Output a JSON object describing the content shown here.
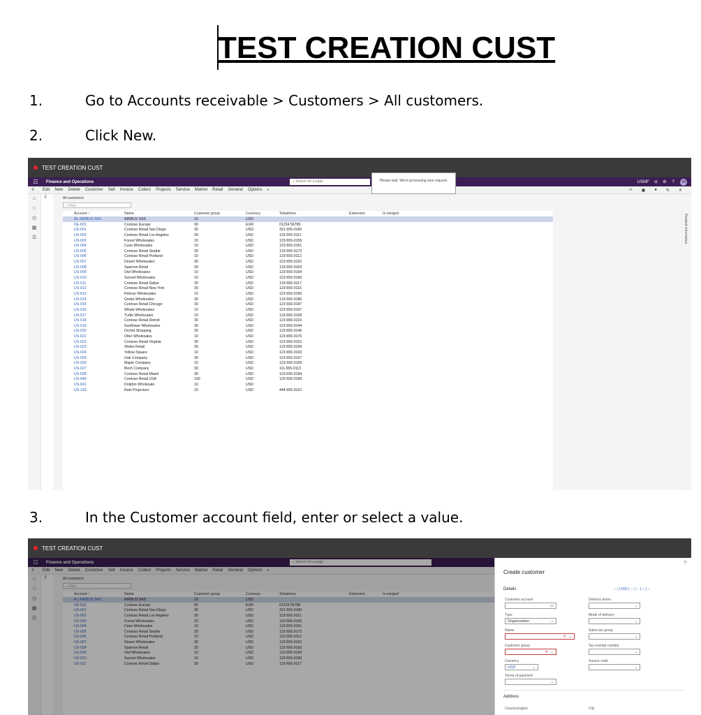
{
  "doc": {
    "title": "TEST CREATION CUST",
    "steps": [
      {
        "num": "1.",
        "text": "Go to Accounts receivable > Customers > All customers."
      },
      {
        "num": "2.",
        "text": "Click New."
      },
      {
        "num": "3.",
        "text": "In the Customer account field, enter or select a value."
      }
    ]
  },
  "app": {
    "window_title": "TEST CREATION CUST",
    "brand": "Finance and Operations",
    "search_placeholder": "Search for a page",
    "company": "USMF",
    "avatar": "VB",
    "help": "?",
    "toast": "Please wait. We're processing your request.",
    "actions": [
      "Edit",
      "New",
      "Delete",
      "Customer",
      "Sell",
      "Invoice",
      "Collect",
      "Projects",
      "Service",
      "Market",
      "Retail",
      "General",
      "Options"
    ],
    "list_title": "All customers",
    "filter_placeholder": "Filter",
    "related_info": "Related information",
    "columns": [
      "Account ↑",
      "Name",
      "Customer group",
      "Currency",
      "Telephone",
      "Extension",
      "Is merged"
    ]
  },
  "rows": [
    [
      "AL-AIRBUS SAS",
      "AIRBUS SAS",
      "10",
      "USD",
      ""
    ],
    [
      "DE-001",
      "Contoso Europe",
      "90",
      "EUR",
      "01234 56789"
    ],
    [
      "US-001",
      "Contoso Retail San Diego",
      "30",
      "USD",
      "321-555-0160"
    ],
    [
      "US-002",
      "Contoso Retail Los Angeles",
      "30",
      "USD",
      "123-555-0111"
    ],
    [
      "US-003",
      "Forest Wholesales",
      "10",
      "USD",
      "123-555-0159"
    ],
    [
      "US-004",
      "Cave Wholesales",
      "10",
      "USD",
      "123-555-0161"
    ],
    [
      "US-005",
      "Contoso Retail Seattle",
      "30",
      "USD",
      "123-555-0172"
    ],
    [
      "US-006",
      "Contoso Retail Portland",
      "10",
      "USD",
      "123-555-0112"
    ],
    [
      "US-007",
      "Desert Wholesales",
      "30",
      "USD",
      "123-555-0162"
    ],
    [
      "US-008",
      "Sparrow Retail",
      "30",
      "USD",
      "123-555-0163"
    ],
    [
      "US-009",
      "Owl Wholesales",
      "10",
      "USD",
      "123-555-0164"
    ],
    [
      "US-010",
      "Sunset Wholesales",
      "10",
      "USD",
      "123-555-0160"
    ],
    [
      "US-011",
      "Contoso Retail Dallas",
      "30",
      "USD",
      "123-555-0117"
    ],
    [
      "US-012",
      "Contoso Retail New York",
      "30",
      "USD",
      "123-555-0116"
    ],
    [
      "US-013",
      "Pelican Wholesales",
      "10",
      "USD",
      "123-555-0165"
    ],
    [
      "US-014",
      "Grebe Wholesales",
      "30",
      "USD",
      "123-555-0180"
    ],
    [
      "US-015",
      "Contoso Retail Chicago",
      "30",
      "USD",
      "123-555-0187"
    ],
    [
      "US-016",
      "Whale Wholesales",
      "10",
      "USD",
      "123-555-0167"
    ],
    [
      "US-017",
      "Turtle Wholesales",
      "10",
      "USD",
      "123-555-0168"
    ],
    [
      "US-018",
      "Contoso Retail Detroit",
      "30",
      "USD",
      "123-555-0119"
    ],
    [
      "US-019",
      "Sunflower Wholesales",
      "30",
      "USD",
      "123-555-0144"
    ],
    [
      "US-020",
      "Orchid Shopping",
      "30",
      "USD",
      "123-555-0146"
    ],
    [
      "US-021",
      "Otter Wholesales",
      "10",
      "USD",
      "123-555-0170"
    ],
    [
      "US-022",
      "Contoso Retail Virginia",
      "30",
      "USD",
      "123-555-0115"
    ],
    [
      "US-023",
      "Shrike Retail",
      "30",
      "USD",
      "123-555-0169"
    ],
    [
      "US-024",
      "Yellow Square",
      "10",
      "USD",
      "123-555-0163"
    ],
    [
      "US-025",
      "Oak Company",
      "30",
      "USD",
      "123-555-0157"
    ],
    [
      "US-026",
      "Maple Company",
      "10",
      "USD",
      "123-555-0155"
    ],
    [
      "US-027",
      "Birch Company",
      "30",
      "USD",
      "111-555-0113"
    ],
    [
      "US-028",
      "Contoso Retail Miami",
      "30",
      "USD",
      "123-555-0184"
    ],
    [
      "US-040",
      "Contoso Retail USA",
      "100",
      "USD",
      "123-555-0199"
    ],
    [
      "US-041",
      "Dolphin Wholesale",
      "10",
      "USD",
      ""
    ],
    [
      "US-103",
      "Rain Projectors",
      "10",
      "USD",
      "444-555-0110"
    ]
  ],
  "create_customer": {
    "title": "Create customer",
    "help": "?",
    "details_label": "Details",
    "details_summary": "--  |  USD  |  --  |  --  |  --  |  --",
    "customer_account_label": "Customer account",
    "type_label": "Type",
    "type_value": "Organization",
    "name_label": "Name",
    "customer_group_label": "Customer group",
    "currency_label": "Currency",
    "currency_value": "USD",
    "terms_label": "Terms of payment",
    "delivery_terms_label": "Delivery terms",
    "mode_delivery_label": "Mode of delivery",
    "sales_tax_label": "Sales tax group",
    "tax_exempt_label": "Tax exempt number",
    "source_code_label": "Source code",
    "address_label": "Address",
    "country_label": "Country/region",
    "city_label": "City"
  }
}
